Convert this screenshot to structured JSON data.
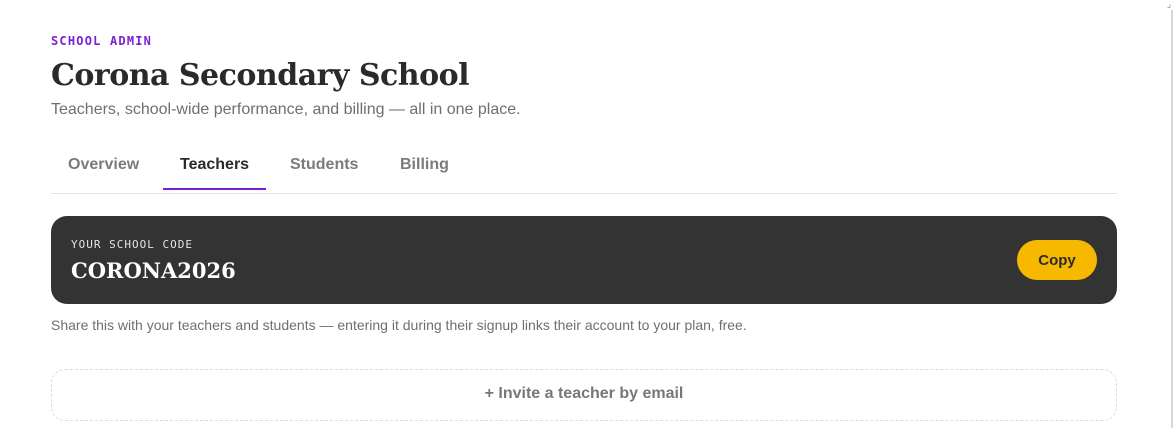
{
  "header": {
    "eyebrow": "SCHOOL ADMIN",
    "title": "Corona Secondary School",
    "subtitle": "Teachers, school-wide performance, and billing — all in one place."
  },
  "tabs": [
    {
      "label": "Overview",
      "active": false
    },
    {
      "label": "Teachers",
      "active": true
    },
    {
      "label": "Students",
      "active": false
    },
    {
      "label": "Billing",
      "active": false
    }
  ],
  "school_code": {
    "label": "YOUR SCHOOL CODE",
    "value": "CORONA2026",
    "copy_label": "Copy"
  },
  "help_text": "Share this with your teachers and students — entering it during their signup links their account to your plan, free.",
  "invite": {
    "label": "+ Invite a teacher by email"
  },
  "colors": {
    "accent": "#7a1fd6",
    "card_bg": "#333333",
    "copy_button": "#f6b900"
  },
  "icons": {
    "corner": "resize-corner-icon"
  }
}
